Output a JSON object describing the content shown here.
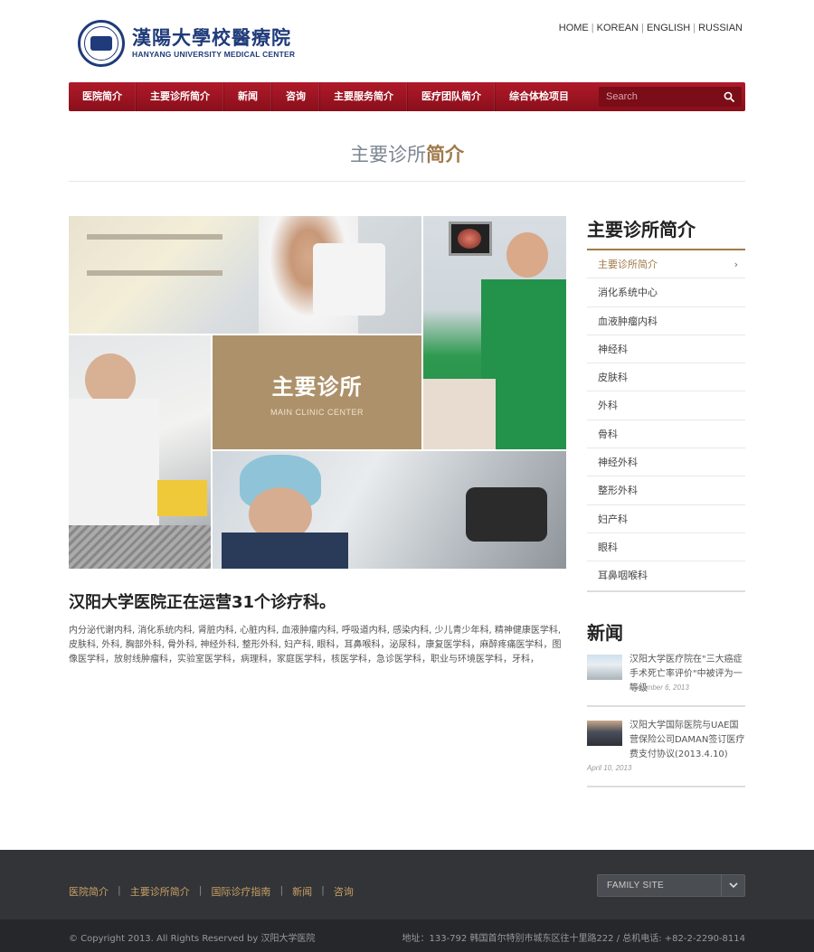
{
  "header": {
    "logo_cn": "漢陽大學校醫療院",
    "logo_en": "HANYANG UNIVERSITY MEDICAL CENTER",
    "languages": [
      "HOME",
      "KOREAN",
      "ENGLISH",
      "RUSSIAN"
    ]
  },
  "nav": {
    "items": [
      "医院简介",
      "主要诊所简介",
      "新闻",
      "咨询",
      "主要服务简介",
      "医疗团队简介",
      "综合体检项目"
    ],
    "search_placeholder": "Search"
  },
  "page_title": {
    "part1": "主要诊所",
    "part2": "简介"
  },
  "hero": {
    "title": "主要诊所",
    "subtitle": "MAIN CLINIC CENTER"
  },
  "main": {
    "heading": "汉阳大学医院正在运营31个诊疗科。",
    "body": "内分泌代谢内科, 消化系统内科, 肾脏内科, 心脏内科, 血液肿瘤内科, 呼吸道内科, 感染内科, 少儿青少年科, 精神健康医学科, 皮肤科, 外科, 胸部外科, 骨外科, 神经外科, 整形外科, 妇产科, 眼科，耳鼻喉科，泌尿科，康复医学科，麻醉疼痛医学科，图像医学科，放射线肿瘤科，实验室医学科，病理科，家庭医学科，核医学科，急诊医学科，职业与环境医学科，牙科，"
  },
  "sidebar": {
    "title": "主要诊所简介",
    "items": [
      "主要诊所简介",
      "消化系统中心",
      "血液肿瘤内科",
      "神经科",
      "皮肤科",
      "外科",
      "骨科",
      "神经外科",
      "整形外科",
      "妇产科",
      "眼科",
      "耳鼻咽喉科"
    ],
    "active_index": 0,
    "chevron": "›"
  },
  "news": {
    "title": "新闻",
    "items": [
      {
        "text": "汉阳大学医疗院在\"三大癌症手术死亡率评价\"中被评为一等级",
        "date": "November 6, 2013"
      },
      {
        "text": "汉阳大学国际医院与UAE国营保险公司DAMAN签订医疗费支付协议(2013.4.10)",
        "date": "April 10, 2013"
      }
    ]
  },
  "footer": {
    "links": [
      "医院简介",
      "主要诊所简介",
      "国际诊疗指南",
      "新闻",
      "咨询"
    ],
    "family_site": "FAMILY SITE",
    "copyright": "© Copyright 2013. All Rights Reserved by 汉阳大学医院",
    "address": "地址：133-792 韩国首尔特别市城东区往十里路222 / 总机电话: +82-2-2290-8114"
  },
  "colors": {
    "nav_red": "#9c1423",
    "accent_gold": "#a07a4a",
    "logo_blue": "#1f3b7a",
    "footer_dark": "#323437"
  }
}
